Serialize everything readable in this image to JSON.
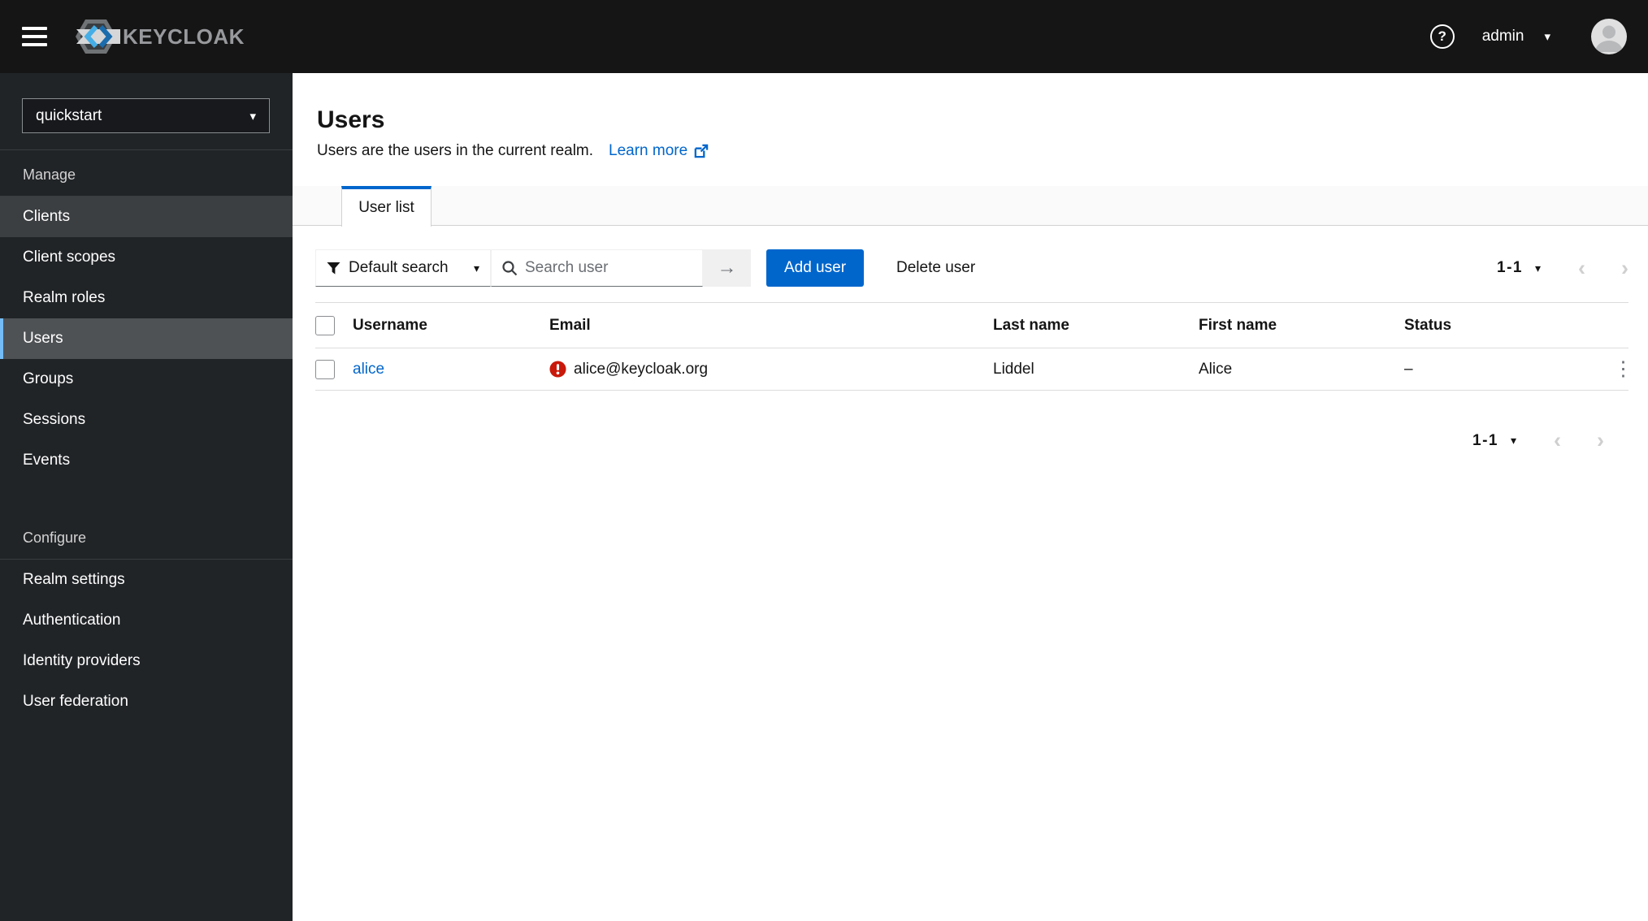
{
  "topbar": {
    "brand": "KEYCLOAK",
    "username": "admin"
  },
  "sidebar": {
    "realm": "quickstart",
    "sections": [
      {
        "label": "Manage",
        "items": [
          {
            "label": "Clients"
          },
          {
            "label": "Client scopes"
          },
          {
            "label": "Realm roles"
          },
          {
            "label": "Users"
          },
          {
            "label": "Groups"
          },
          {
            "label": "Sessions"
          },
          {
            "label": "Events"
          }
        ]
      },
      {
        "label": "Configure",
        "items": [
          {
            "label": "Realm settings"
          },
          {
            "label": "Authentication"
          },
          {
            "label": "Identity providers"
          },
          {
            "label": "User federation"
          }
        ]
      }
    ]
  },
  "page": {
    "title": "Users",
    "subtitle": "Users are the users in the current realm.",
    "learn_more_label": "Learn more",
    "active_tab": "User list"
  },
  "toolbar": {
    "filter_label": "Default search",
    "search_placeholder": "Search user",
    "add_button": "Add user",
    "delete_button": "Delete user",
    "pagination": "1-1"
  },
  "table": {
    "columns": [
      "Username",
      "Email",
      "Last name",
      "First name",
      "Status"
    ],
    "rows": [
      {
        "username": "alice",
        "email": "alice@keycloak.org",
        "email_unverified": true,
        "last_name": "Liddel",
        "first_name": "Alice",
        "status": "–"
      }
    ]
  },
  "footer": {
    "pagination": "1-1"
  },
  "glyphs": {
    "help": "?",
    "caret_down": "▾",
    "chevron_left": "‹",
    "chevron_right": "›",
    "arrow_right": "→",
    "kebab": "⋮"
  },
  "colors": {
    "primary": "#0066cc",
    "danger": "#c9190b",
    "topbar_bg": "#151515",
    "sidebar_bg": "#212427",
    "nav_selected_bg": "#4f5255",
    "nav_accent": "#73bcf7",
    "tab_strip_bg": "#fafafa"
  }
}
